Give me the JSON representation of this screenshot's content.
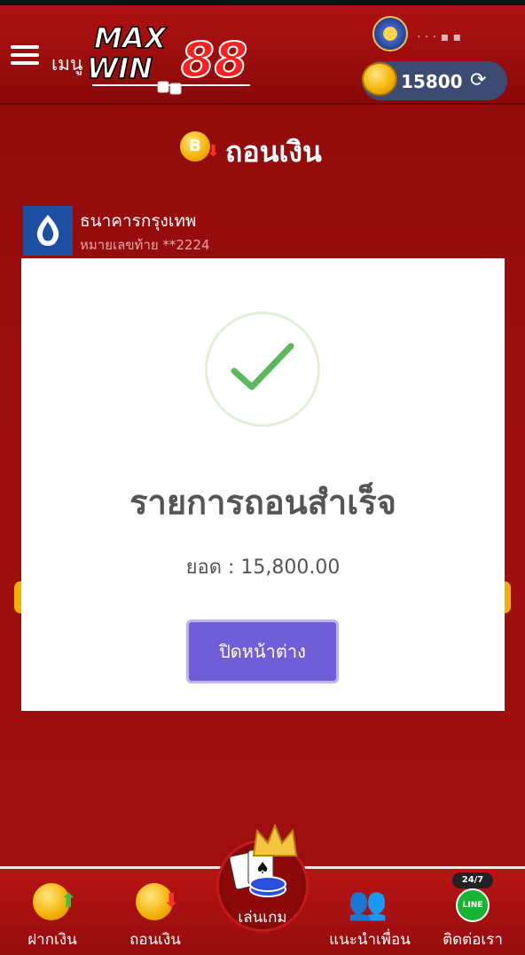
{
  "header": {
    "menu_label": "เมนู",
    "logo": "MAXWIN88",
    "username": "· · · ▪ ▪",
    "balance": "15800"
  },
  "page": {
    "title": "ถอนเงิน",
    "title_coin_letter": "B"
  },
  "bank": {
    "name": "ธนาคารกรุงเทพ",
    "account": "หมายเลขท้าย **2224"
  },
  "modal": {
    "title": "รายการถอนสำเร็จ",
    "amount": "ยอด : 15,800.00",
    "close_label": "ปิดหน้าต่าง"
  },
  "bottom_nav": {
    "deposit": "ฝากเงิน",
    "withdraw": "ถอนเงิน",
    "play": "เล่นเกม",
    "refer": "แนะนำเพื่อน",
    "contact": "ติดต่อเรา",
    "contact_badge": "24/7",
    "line_text": "LINE"
  },
  "colors": {
    "primary_red": "#9b0e0e",
    "button_purple": "#6f5ed8",
    "check_green": "#5cb85c",
    "coin_gold": "#f2b100"
  }
}
